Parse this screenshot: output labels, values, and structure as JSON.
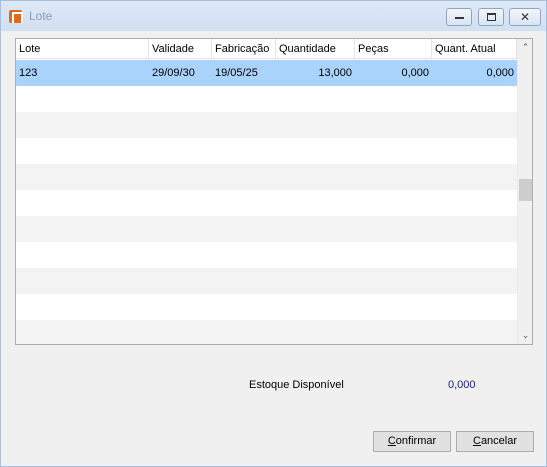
{
  "window": {
    "title": "Lote",
    "close_glyph": "✕"
  },
  "grid": {
    "columns": [
      "Lote",
      "Validade",
      "Fabricação",
      "Quantidade",
      "Peças",
      "Quant. Atual"
    ],
    "rows": [
      {
        "lote": "123",
        "validade": "29/09/30",
        "fabricacao": "19/05/25",
        "quantidade": "13,000",
        "pecas": "0,000",
        "quant_atual": "0,000",
        "selected": true
      }
    ],
    "scroll_up_glyph": "⌃",
    "scroll_down_glyph": "⌄"
  },
  "stock": {
    "label": "Estoque Disponível",
    "value": "0,000"
  },
  "buttons": {
    "confirm_prefix": "C",
    "confirm_rest": "onfirmar",
    "cancel_prefix": "C",
    "cancel_rest": "ancelar"
  },
  "colors": {
    "selected_row": "#a9d3fb",
    "stock_value": "#1a237e",
    "app_icon": "#e06a1a"
  }
}
